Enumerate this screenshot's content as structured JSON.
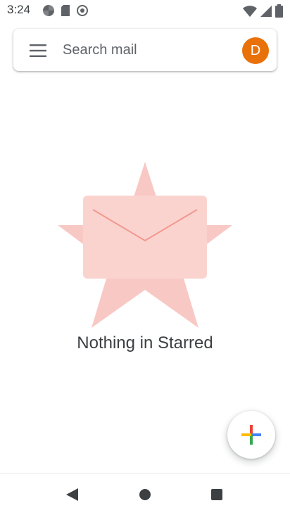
{
  "status_bar": {
    "time": "3:24",
    "icons_left": [
      "google-photos-icon",
      "sd-card-icon",
      "location-icon"
    ],
    "icons_right": [
      "wifi-icon",
      "signal-icon",
      "battery-icon"
    ]
  },
  "search": {
    "placeholder": "Search mail",
    "menu_icon": "hamburger-menu-icon",
    "avatar_letter": "D",
    "avatar_color": "#e8710a"
  },
  "empty_state": {
    "message": "Nothing in Starred",
    "illustration": "starred-envelope-illustration",
    "star_color": "#f8c6c1",
    "envelope_color": "#fad3cf"
  },
  "compose": {
    "icon": "plus-icon"
  },
  "nav": {
    "icons": [
      "back-icon",
      "home-icon",
      "recents-icon"
    ]
  }
}
